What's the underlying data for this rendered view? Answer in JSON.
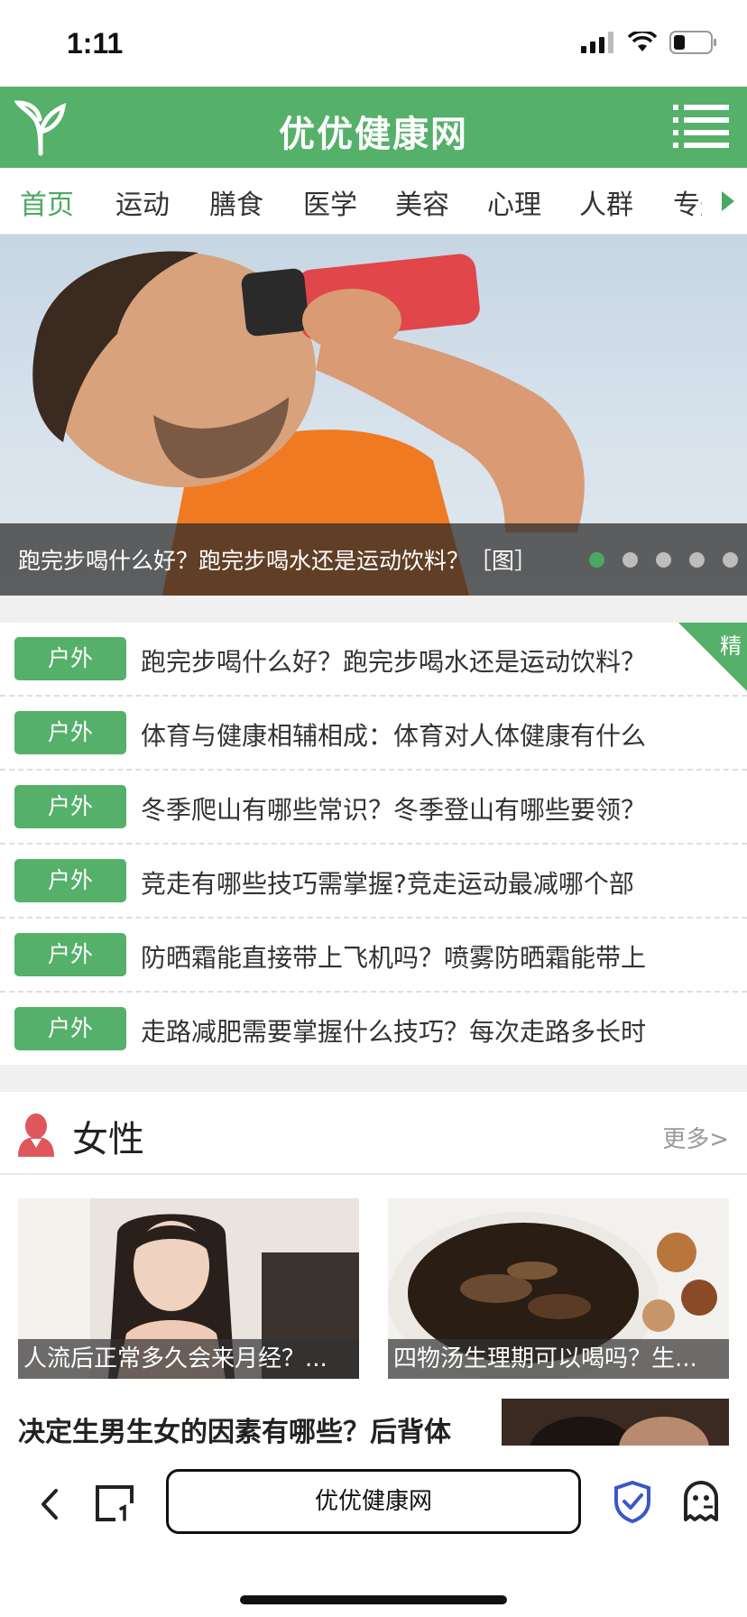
{
  "status_bar": {
    "time": "1:11",
    "icons": [
      "signal-icon",
      "wifi-icon",
      "battery-icon"
    ]
  },
  "header": {
    "title": "优优健康网",
    "logo_icon": "sprout-icon",
    "menu_icon": "menu-icon"
  },
  "tabs": [
    {
      "label": "首页",
      "active": true
    },
    {
      "label": "运动"
    },
    {
      "label": "膳食"
    },
    {
      "label": "医学"
    },
    {
      "label": "美容"
    },
    {
      "label": "心理"
    },
    {
      "label": "人群"
    },
    {
      "label": "专题"
    }
  ],
  "banner": {
    "caption": "跑完步喝什么好？跑完步喝水还是运动饮料？［图］",
    "dots_total": 5,
    "active_dot": 1
  },
  "news": {
    "badge": "精",
    "items": [
      {
        "tag": "户外",
        "title": "跑完步喝什么好？跑完步喝水还是运动饮料？"
      },
      {
        "tag": "户外",
        "title": "体育与健康相辅相成：体育对人体健康有什么"
      },
      {
        "tag": "户外",
        "title": "冬季爬山有哪些常识？冬季登山有哪些要领？"
      },
      {
        "tag": "户外",
        "title": "竞走有哪些技巧需掌握?竞走运动最减哪个部"
      },
      {
        "tag": "户外",
        "title": "防晒霜能直接带上飞机吗？喷雾防晒霜能带上"
      },
      {
        "tag": "户外",
        "title": "走路减肥需要掌握什么技巧？每次走路多长时"
      }
    ]
  },
  "section_female": {
    "title": "女性",
    "more": "更多>",
    "cards": [
      {
        "caption": "人流后正常多久会来月经？..."
      },
      {
        "caption": "四物汤生理期可以喝吗？生..."
      }
    ],
    "article_title": "决定生男生女的因素有哪些？后背体"
  },
  "browser": {
    "url_text": "优优健康网"
  },
  "colors": {
    "brand_green": "#55b06a",
    "tab_active": "#4aa862"
  }
}
